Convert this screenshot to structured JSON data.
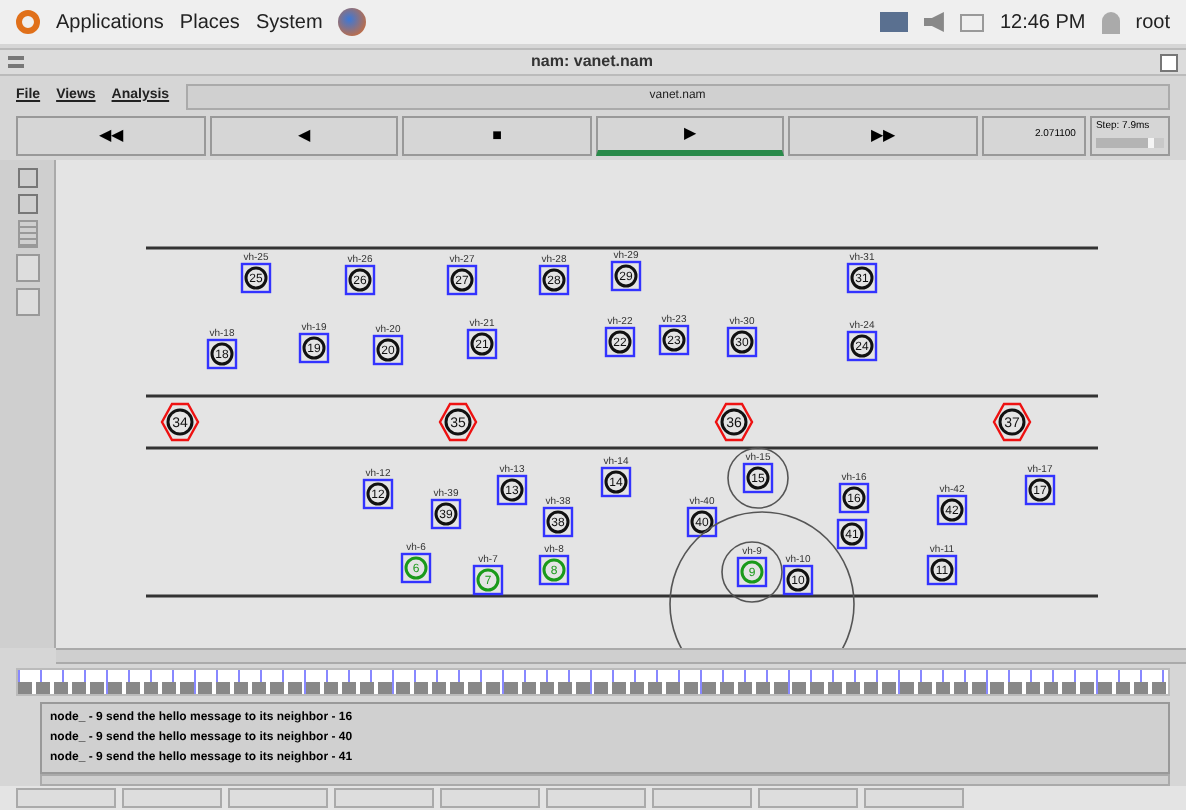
{
  "top_panel": {
    "menus": [
      "Applications",
      "Places",
      "System"
    ],
    "clock": "12:46 PM",
    "user": "root"
  },
  "window": {
    "title": "nam: vanet.nam"
  },
  "menu_bar": {
    "items": [
      "File",
      "Views",
      "Analysis"
    ],
    "file_name": "vanet.nam"
  },
  "transport": {
    "buttons": [
      {
        "symbol": "◀◀",
        "selected": false
      },
      {
        "symbol": "◀",
        "selected": false
      },
      {
        "symbol": "■",
        "selected": false
      },
      {
        "symbol": "▶",
        "selected": true
      },
      {
        "symbol": "▶▶",
        "selected": false
      }
    ],
    "time": "2.071100",
    "step": "Step: 7.9ms",
    "step_slider": {
      "level": 0.85
    }
  },
  "nodes": [
    {
      "label": "vh-25",
      "number": "25",
      "kind": "vehicle",
      "active": false,
      "ringed": false,
      "broadcast": false
    },
    {
      "label": "vh-26",
      "number": "26",
      "kind": "vehicle",
      "active": false,
      "ringed": false,
      "broadcast": false
    },
    {
      "label": "vh-27",
      "number": "27",
      "kind": "vehicle",
      "active": false,
      "ringed": false,
      "broadcast": false
    },
    {
      "label": "vh-28",
      "number": "28",
      "kind": "vehicle",
      "active": false,
      "ringed": false,
      "broadcast": false
    },
    {
      "label": "vh-29",
      "number": "29",
      "kind": "vehicle",
      "active": false,
      "ringed": false,
      "broadcast": false
    },
    {
      "label": "vh-31",
      "number": "31",
      "kind": "vehicle",
      "active": false,
      "ringed": false,
      "broadcast": false
    },
    {
      "label": "vh-18",
      "number": "18",
      "kind": "vehicle",
      "active": false,
      "ringed": false,
      "broadcast": false
    },
    {
      "label": "vh-19",
      "number": "19",
      "kind": "vehicle",
      "active": false,
      "ringed": false,
      "broadcast": false
    },
    {
      "label": "vh-20",
      "number": "20",
      "kind": "vehicle",
      "active": false,
      "ringed": false,
      "broadcast": false
    },
    {
      "label": "vh-21",
      "number": "21",
      "kind": "vehicle",
      "active": false,
      "ringed": false,
      "broadcast": false
    },
    {
      "label": "vh-22",
      "number": "22",
      "kind": "vehicle",
      "active": false,
      "ringed": false,
      "broadcast": false
    },
    {
      "label": "vh-23",
      "number": "23",
      "kind": "vehicle",
      "active": false,
      "ringed": false,
      "broadcast": false
    },
    {
      "label": "vh-30",
      "number": "30",
      "kind": "vehicle",
      "active": false,
      "ringed": false,
      "broadcast": false
    },
    {
      "label": "vh-24",
      "number": "24",
      "kind": "vehicle",
      "active": false,
      "ringed": false,
      "broadcast": false
    },
    {
      "number": "34",
      "kind": "rsu",
      "active": false,
      "ringed": false,
      "broadcast": false
    },
    {
      "number": "35",
      "kind": "rsu",
      "active": false,
      "ringed": false,
      "broadcast": false
    },
    {
      "number": "36",
      "kind": "rsu",
      "active": false,
      "ringed": false,
      "broadcast": false
    },
    {
      "number": "37",
      "kind": "rsu",
      "active": false,
      "ringed": false,
      "broadcast": false
    },
    {
      "label": "vh-12",
      "number": "12",
      "kind": "vehicle",
      "active": false,
      "ringed": false,
      "broadcast": false
    },
    {
      "label": "vh-39",
      "number": "39",
      "kind": "vehicle",
      "active": false,
      "ringed": false,
      "broadcast": false
    },
    {
      "label": "vh-13",
      "number": "13",
      "kind": "vehicle",
      "active": false,
      "ringed": false,
      "broadcast": false
    },
    {
      "label": "vh-38",
      "number": "38",
      "kind": "vehicle",
      "active": false,
      "ringed": false,
      "broadcast": false
    },
    {
      "label": "vh-14",
      "number": "14",
      "kind": "vehicle",
      "active": false,
      "ringed": false,
      "broadcast": false
    },
    {
      "label": "vh-40",
      "number": "40",
      "kind": "vehicle",
      "active": false,
      "ringed": false,
      "broadcast": false
    },
    {
      "label": "vh-15",
      "number": "15",
      "kind": "vehicle",
      "active": false,
      "ringed": true,
      "broadcast": false
    },
    {
      "label": "vh-16",
      "number": "16",
      "kind": "vehicle",
      "active": false,
      "ringed": false,
      "broadcast": false
    },
    {
      "number": "41",
      "kind": "vehicle",
      "active": false,
      "ringed": false,
      "broadcast": false
    },
    {
      "label": "vh-42",
      "number": "42",
      "kind": "vehicle",
      "active": false,
      "ringed": false,
      "broadcast": false
    },
    {
      "label": "vh-17",
      "number": "17",
      "kind": "vehicle",
      "active": false,
      "ringed": false,
      "broadcast": false
    },
    {
      "label": "vh-6",
      "number": "6",
      "kind": "vehicle",
      "active": true,
      "ringed": false,
      "broadcast": false
    },
    {
      "label": "vh-7",
      "number": "7",
      "kind": "vehicle",
      "active": true,
      "ringed": false,
      "broadcast": false
    },
    {
      "label": "vh-8",
      "number": "8",
      "kind": "vehicle",
      "active": true,
      "ringed": false,
      "broadcast": false
    },
    {
      "label": "vh-9",
      "number": "9",
      "kind": "vehicle",
      "active": true,
      "ringed": true,
      "broadcast": true
    },
    {
      "label": "vh-10",
      "number": "10",
      "kind": "vehicle",
      "active": false,
      "ringed": false,
      "broadcast": false
    },
    {
      "label": "vh-11",
      "number": "11",
      "kind": "vehicle",
      "active": false,
      "ringed": false,
      "broadcast": false
    }
  ],
  "log": [
    "node_ - 9 send the hello message to its neighbor - 16",
    "node_ - 9 send the hello message to its neighbor - 40",
    "node_ - 9 send the hello message to its neighbor - 41"
  ]
}
